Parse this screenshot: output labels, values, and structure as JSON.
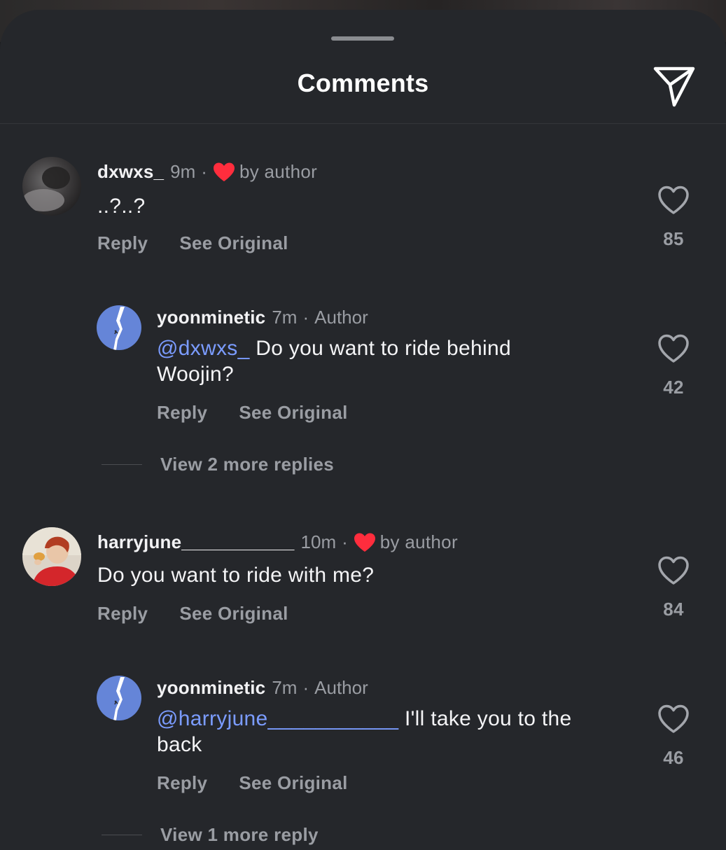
{
  "sheet": {
    "title": "Comments"
  },
  "comments": [
    {
      "username": "dxwxs_",
      "time": "9m",
      "badge": "by author",
      "text": "..?..?",
      "reply_label": "Reply",
      "see_original_label": "See Original",
      "likes": "85",
      "replies": [
        {
          "username": "yoonminetic",
          "time": "7m",
          "role": "Author",
          "mention": "@dxwxs_",
          "text_line1": "Do you want to ride behind",
          "text_line2": "Woojin?",
          "reply_label": "Reply",
          "see_original_label": "See Original",
          "likes": "42"
        }
      ],
      "view_more": "View 2 more replies"
    },
    {
      "username": "harryjune___________",
      "time": "10m",
      "badge": "by author",
      "text": "Do you want to ride with me?",
      "reply_label": "Reply",
      "see_original_label": "See Original",
      "likes": "84",
      "replies": [
        {
          "username": "yoonminetic",
          "time": "7m",
          "role": "Author",
          "mention": "@harryjune___________",
          "text_line1": "I'll take you to the",
          "text_line2": "back",
          "reply_label": "Reply",
          "see_original_label": "See Original",
          "likes": "46"
        }
      ],
      "view_more": "View 1 more reply"
    }
  ],
  "colors": {
    "sheet_bg": "#25272b",
    "text_primary": "#f4f4f6",
    "text_secondary": "#9a9da3",
    "mention": "#7b9cff",
    "heart_red": "#ff2d3d"
  },
  "icons": {
    "share": "paper-plane-icon",
    "like": "heart-outline-icon",
    "badge": "heart-filled-icon"
  }
}
